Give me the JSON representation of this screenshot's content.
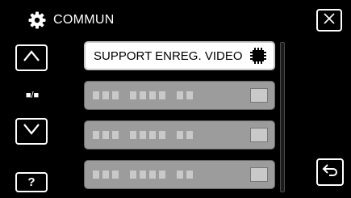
{
  "header": {
    "title": "COMMUN",
    "icon": "gear-icon"
  },
  "buttons": {
    "close_icon": "close-icon",
    "up_icon": "chevron-up-icon",
    "down_icon": "chevron-down-icon",
    "help_label": "?",
    "back_icon": "return-icon"
  },
  "page_indicator": "■/■",
  "menu": {
    "items": [
      {
        "label": "SUPPORT ENREG. VIDEO",
        "state": "selected"
      },
      {
        "label": "",
        "state": "disabled"
      },
      {
        "label": "",
        "state": "disabled"
      },
      {
        "label": "",
        "state": "disabled"
      }
    ]
  }
}
